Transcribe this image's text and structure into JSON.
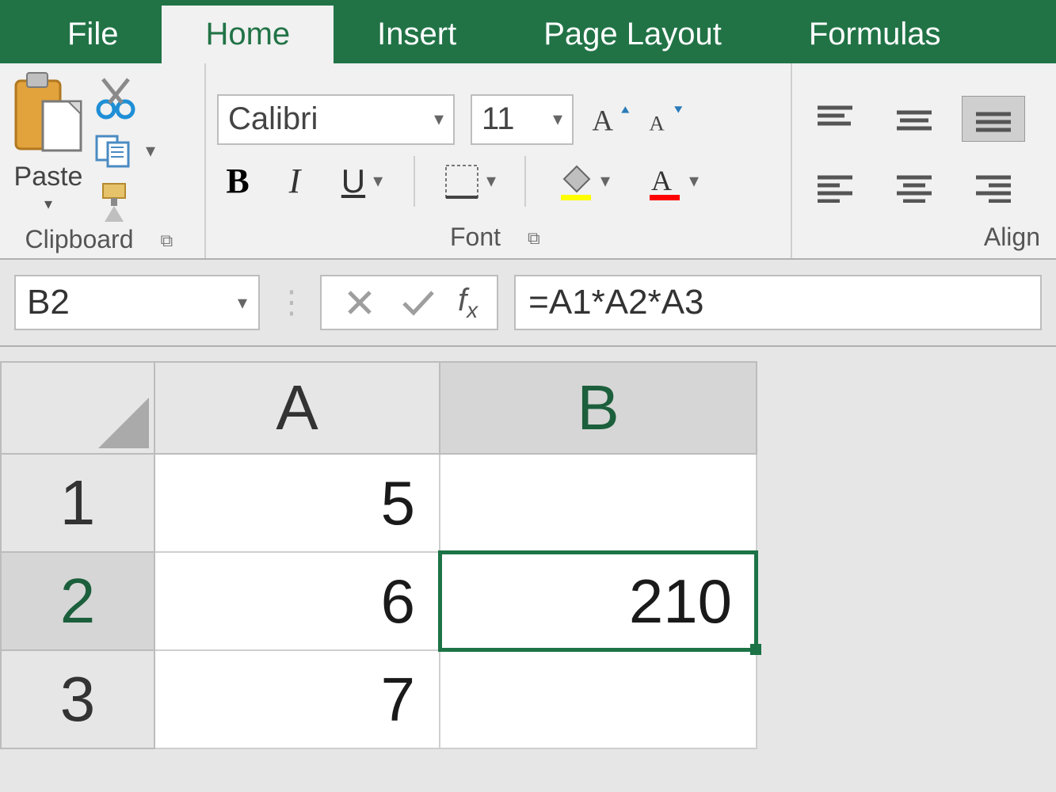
{
  "tabs": {
    "file": "File",
    "home": "Home",
    "insert": "Insert",
    "pagelayout": "Page Layout",
    "formulas": "Formulas"
  },
  "clipboard": {
    "paste_label": "Paste",
    "group_label": "Clipboard"
  },
  "font": {
    "name": "Calibri",
    "size": "11",
    "group_label": "Font"
  },
  "align": {
    "group_label": "Align"
  },
  "formula_bar": {
    "name_box": "B2",
    "formula": "=A1*A2*A3"
  },
  "columns": {
    "A": "A",
    "B": "B"
  },
  "rows": {
    "r1": "1",
    "r2": "2",
    "r3": "3"
  },
  "cells": {
    "A1": "5",
    "A2": "6",
    "A3": "7",
    "B1": "",
    "B2": "210",
    "B3": ""
  }
}
